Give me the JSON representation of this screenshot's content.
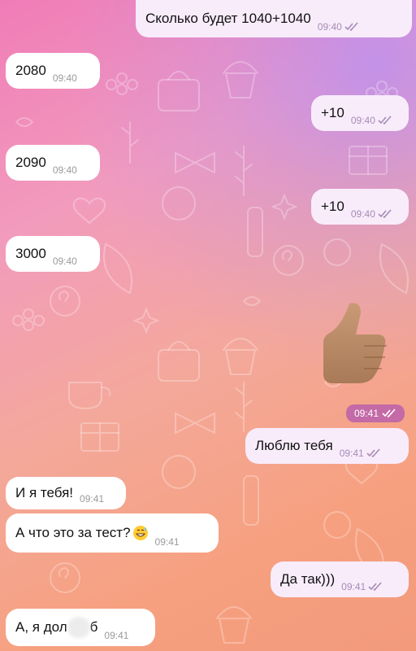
{
  "messages": [
    {
      "text": "Сколько будет 1040+1040",
      "time": "09:40",
      "side": "out"
    },
    {
      "text": "2080",
      "time": "09:40",
      "side": "in"
    },
    {
      "text": "+10",
      "time": "09:40",
      "side": "out"
    },
    {
      "text": "2090",
      "time": "09:40",
      "side": "in"
    },
    {
      "text": "+10",
      "time": "09:40",
      "side": "out"
    },
    {
      "text": "3000",
      "time": "09:40",
      "side": "in"
    },
    {
      "sticker": "thumbs-up",
      "time": "09:41",
      "side": "out"
    },
    {
      "text": "Люблю тебя",
      "time": "09:41",
      "side": "out"
    },
    {
      "text": "И я тебя!",
      "time": "09:41",
      "side": "in"
    },
    {
      "text": "А что это за тест?",
      "emoji": "grinning-sweat-emoji",
      "time": "09:41",
      "side": "in"
    },
    {
      "text": "Да так)))",
      "time": "09:41",
      "side": "out"
    },
    {
      "text_before": "А, я дол",
      "text_after": "б",
      "time": "09:41",
      "side": "in",
      "blurred": true
    }
  ],
  "colors": {
    "incoming_bubble": "#ffffff",
    "outgoing_bubble": "#f8ecfb",
    "time_pill": "#c46aa7",
    "read_check": "#a78ab4"
  }
}
